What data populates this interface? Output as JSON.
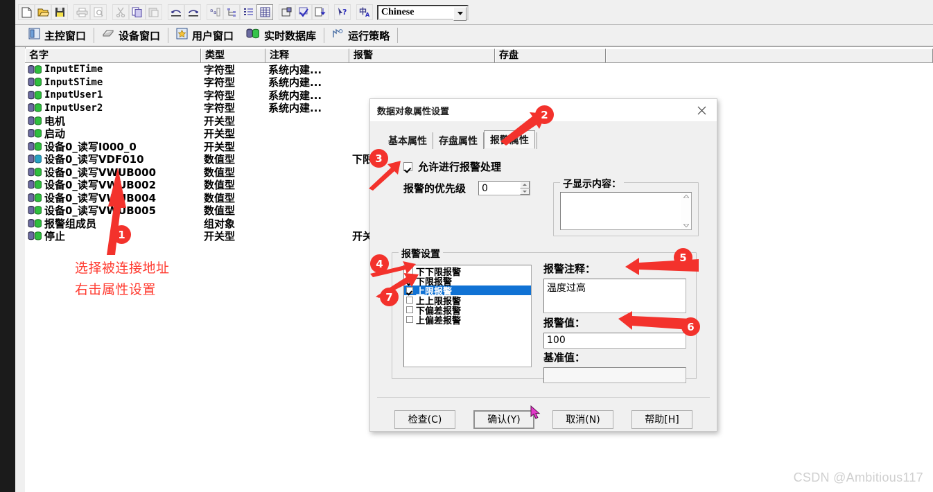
{
  "toolbar": {
    "buttons": [
      {
        "name": "new-icon",
        "label": "New"
      },
      {
        "name": "open-icon",
        "label": "Open"
      },
      {
        "name": "save-icon",
        "label": "Save"
      },
      {
        "name": "print-icon",
        "label": "Print"
      },
      {
        "name": "print-preview-icon",
        "label": "Print Preview"
      },
      {
        "name": "cut-icon",
        "label": "Cut"
      },
      {
        "name": "copy-icon",
        "label": "Copy"
      },
      {
        "name": "paste-icon",
        "label": "Paste"
      },
      {
        "name": "undo-icon",
        "label": "Undo"
      },
      {
        "name": "redo-icon",
        "label": "Redo"
      },
      {
        "name": "sort-icon",
        "label": "Sort"
      },
      {
        "name": "tree-icon",
        "label": "Tree"
      },
      {
        "name": "list-icon",
        "label": "List"
      },
      {
        "name": "grid-icon",
        "label": "Grid"
      },
      {
        "name": "properties-icon",
        "label": "Properties"
      },
      {
        "name": "check-icon",
        "label": "Check"
      },
      {
        "name": "download-icon",
        "label": "Download"
      },
      {
        "name": "help-pointer-icon",
        "label": "Context Help"
      },
      {
        "name": "language-icon",
        "label": "Language"
      }
    ],
    "language_combo": {
      "value": "Chinese",
      "arrow": "▼"
    }
  },
  "menu": {
    "items": [
      {
        "label": "主控窗口",
        "icon": "main-window-icon",
        "name": "menu-item-main-window"
      },
      {
        "label": "设备窗口",
        "icon": "device-window-icon",
        "name": "menu-item-device-window"
      },
      {
        "label": "用户窗口",
        "icon": "user-window-icon",
        "name": "menu-item-user-window"
      },
      {
        "label": "实时数据库",
        "icon": "realtime-db-icon",
        "name": "menu-item-realtime-db"
      },
      {
        "label": "运行策略",
        "icon": "run-strategy-icon",
        "name": "menu-item-run-strategy"
      }
    ]
  },
  "list": {
    "columns": [
      "名字",
      "类型",
      "注释",
      "报警",
      "存盘"
    ],
    "rows": [
      {
        "name": "InputETime",
        "type": "字符型",
        "note": "系统内建...",
        "alarm": "",
        "save": "",
        "mono": true,
        "icon_color": "green"
      },
      {
        "name": "InputSTime",
        "type": "字符型",
        "note": "系统内建...",
        "alarm": "",
        "save": "",
        "mono": true,
        "icon_color": "green"
      },
      {
        "name": "InputUser1",
        "type": "字符型",
        "note": "系统内建...",
        "alarm": "",
        "save": "",
        "mono": true,
        "icon_color": "green"
      },
      {
        "name": "InputUser2",
        "type": "字符型",
        "note": "系统内建...",
        "alarm": "",
        "save": "",
        "mono": true,
        "icon_color": "green"
      },
      {
        "name": "电机",
        "type": "开关型",
        "note": "",
        "alarm": "",
        "save": "",
        "mono": false,
        "icon_color": "green"
      },
      {
        "name": "启动",
        "type": "开关型",
        "note": "",
        "alarm": "",
        "save": "",
        "mono": false,
        "icon_color": "green"
      },
      {
        "name": "设备0_读写I000_0",
        "type": "开关型",
        "note": "",
        "alarm": "",
        "save": "",
        "mono": false,
        "icon_color": "green"
      },
      {
        "name": "设备0_读写VDF010",
        "type": "数值型",
        "note": "",
        "alarm": "下限报...",
        "save": "",
        "mono": false,
        "icon_color": "blue"
      },
      {
        "name": "设备0_读写VWUB000",
        "type": "数值型",
        "note": "",
        "alarm": "",
        "save": "",
        "mono": false,
        "icon_color": "green"
      },
      {
        "name": "设备0_读写VWUB002",
        "type": "数值型",
        "note": "",
        "alarm": "",
        "save": "",
        "mono": false,
        "icon_color": "green"
      },
      {
        "name": "设备0_读写VWUB004",
        "type": "数值型",
        "note": "",
        "alarm": "",
        "save": "",
        "mono": false,
        "icon_color": "green"
      },
      {
        "name": "设备0_读写VWUB005",
        "type": "数值型",
        "note": "",
        "alarm": "",
        "save": "",
        "mono": false,
        "icon_color": "green"
      },
      {
        "name": "报警组成员",
        "type": "组对象",
        "note": "",
        "alarm": "",
        "save": "",
        "mono": false,
        "icon_color": "green"
      },
      {
        "name": "停止",
        "type": "开关型",
        "note": "",
        "alarm": "开关量",
        "save": "",
        "mono": false,
        "icon_color": "green"
      }
    ]
  },
  "annotations": {
    "note_line1": "选择被连接地址",
    "note_line2": "右击属性设置",
    "badges": [
      "1",
      "2",
      "3",
      "4",
      "5",
      "6",
      "7"
    ]
  },
  "dialog": {
    "title": "数据对象属性设置",
    "close_icon": "close-icon",
    "tabs": [
      {
        "label": "基本属性",
        "active": false
      },
      {
        "label": "存盘属性",
        "active": false
      },
      {
        "label": "报警属性",
        "active": true
      }
    ],
    "enable_alarm": {
      "label": "允许进行报警处理",
      "checked": true
    },
    "priority": {
      "label": "报警的优先级",
      "value": "0"
    },
    "sub_display": {
      "label": "子显示内容：",
      "value": ""
    },
    "alarm_settings": {
      "label": "报警设置",
      "items": [
        {
          "label": "下下限报警",
          "checked": false,
          "selected": false
        },
        {
          "label": "下限报警",
          "checked": true,
          "selected": false
        },
        {
          "label": "上限报警",
          "checked": true,
          "selected": true
        },
        {
          "label": "上上限报警",
          "checked": false,
          "selected": false
        },
        {
          "label": "下偏差报警",
          "checked": false,
          "selected": false
        },
        {
          "label": "上偏差报警",
          "checked": false,
          "selected": false
        }
      ],
      "comment_label": "报警注释：",
      "comment_value": "温度过高",
      "value_label": "报警值：",
      "value_value": "100",
      "base_label": "基准值：",
      "base_value": ""
    },
    "buttons": [
      {
        "label": "检查(C)",
        "name": "check-button",
        "default": false
      },
      {
        "label": "确认(Y)",
        "name": "confirm-button",
        "default": true
      },
      {
        "label": "取消(N)",
        "name": "cancel-button",
        "default": false
      },
      {
        "label": "帮助[H]",
        "name": "help-button",
        "default": false
      }
    ]
  },
  "watermark": "CSDN @Ambitious117",
  "colors": {
    "accent_red": "#f3322c",
    "selection_blue": "#1072d4",
    "toolbar_bg": "#f0f0f0"
  }
}
